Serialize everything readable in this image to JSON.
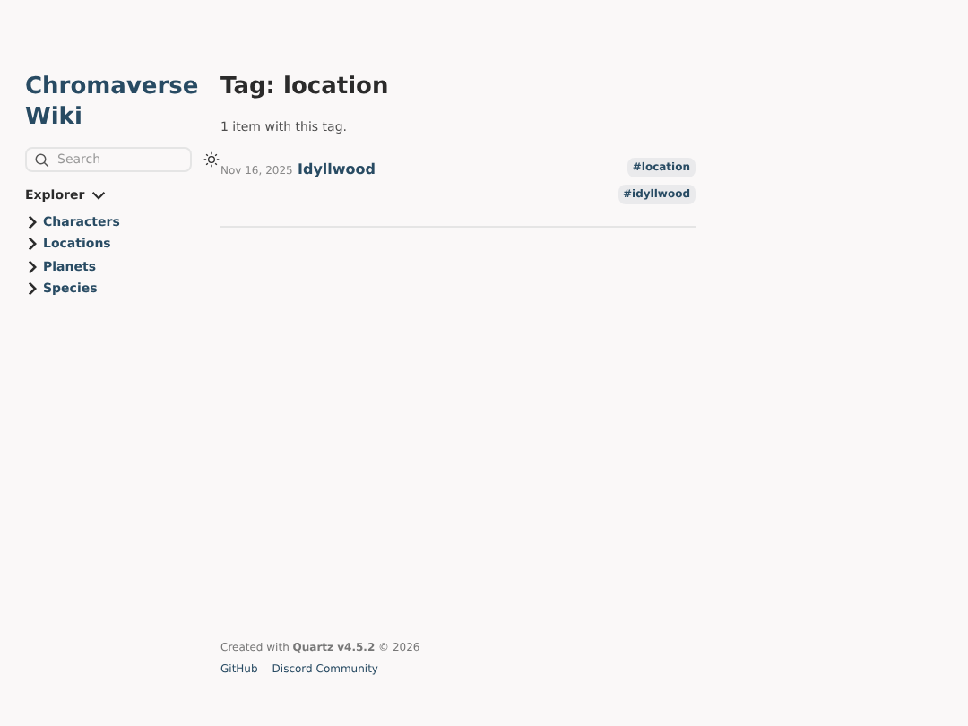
{
  "site_title": "Chromaverse Wiki",
  "search": {
    "placeholder": "Search"
  },
  "explorer": {
    "title": "Explorer",
    "expanded": true,
    "items": [
      {
        "label": "Characters",
        "expanded": false
      },
      {
        "label": "Locations",
        "expanded": false
      },
      {
        "label": "Planets",
        "expanded": false
      },
      {
        "label": "Species",
        "expanded": false
      }
    ]
  },
  "page": {
    "title": "Tag: location",
    "summary": "1 item with this tag.",
    "items": [
      {
        "date": "Nov 16, 2025",
        "title": "Idyllwood",
        "tags": [
          "#location",
          "#idyllwood"
        ]
      }
    ]
  },
  "footer": {
    "credit": "Created with **Quartz v4.5.2** © 2026",
    "links": [
      "GitHub",
      "Discord Community"
    ]
  }
}
